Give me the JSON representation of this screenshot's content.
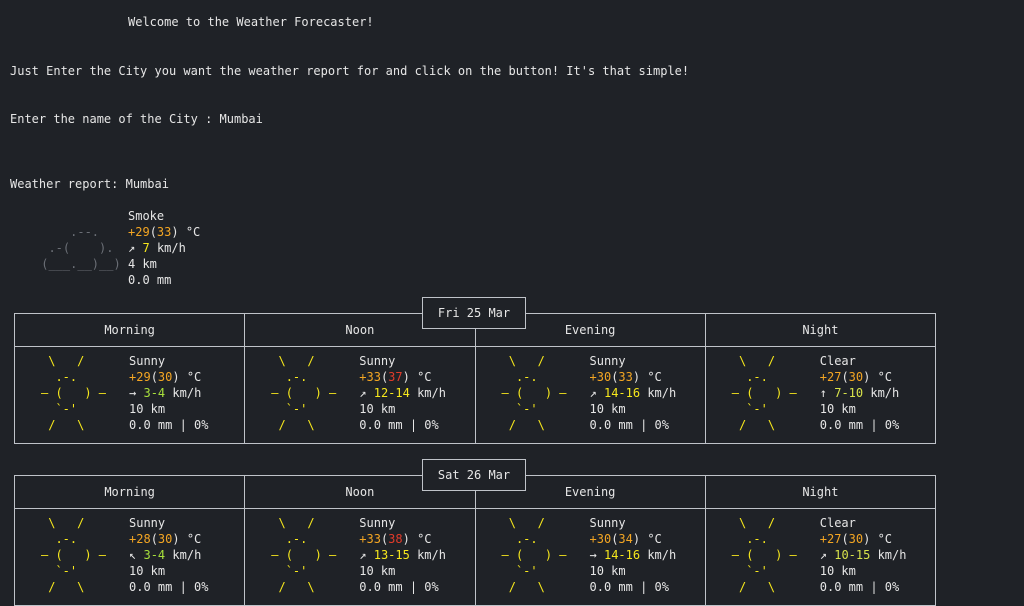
{
  "welcome": "Welcome to the Weather Forecaster!",
  "instructions": "Just Enter the City you want the weather report for and click on the button! It's that simple!",
  "prompt_label": "Enter the name of the City : ",
  "city_value": "Mumbai",
  "report_label": "Weather report: Mumbai",
  "current": {
    "condition": "Smoke",
    "temp_a": "+29",
    "temp_b": "33",
    "temp_unit": "°C",
    "wind_arrow": "↗",
    "wind": "7",
    "wind_unit": "km/h",
    "visibility": "4 km",
    "precip": "0.0 mm"
  },
  "days": [
    {
      "date": "Fri 25 Mar",
      "periods": [
        {
          "name": "Morning",
          "condition": "Sunny",
          "temp_a": "+29",
          "temp_b": "30",
          "temp_b_color": "orange",
          "arrow": "→",
          "wind": "3-4",
          "wind_color": "green",
          "vis": "10 km",
          "precip": "0.0 mm | 0%"
        },
        {
          "name": "Noon",
          "condition": "Sunny",
          "temp_a": "+33",
          "temp_b": "37",
          "temp_b_color": "red",
          "arrow": "↗",
          "wind": "12-14",
          "wind_color": "yellow",
          "vis": "10 km",
          "precip": "0.0 mm | 0%"
        },
        {
          "name": "Evening",
          "condition": "Sunny",
          "temp_a": "+30",
          "temp_b": "33",
          "temp_b_color": "orange",
          "arrow": "↗",
          "wind": "14-16",
          "wind_color": "yellow",
          "vis": "10 km",
          "precip": "0.0 mm | 0%"
        },
        {
          "name": "Night",
          "condition": "Clear",
          "temp_a": "+27",
          "temp_b": "30",
          "temp_b_color": "orange",
          "arrow": "↑",
          "wind": "7-10",
          "wind_color": "yellowgreen",
          "vis": "10 km",
          "precip": "0.0 mm | 0%"
        }
      ]
    },
    {
      "date": "Sat 26 Mar",
      "periods": [
        {
          "name": "Morning",
          "condition": "Sunny",
          "temp_a": "+28",
          "temp_b": "30",
          "temp_b_color": "orange",
          "arrow": "↖",
          "wind": "3-4",
          "wind_color": "green",
          "vis": "10 km",
          "precip": "0.0 mm | 0%"
        },
        {
          "name": "Noon",
          "condition": "Sunny",
          "temp_a": "+33",
          "temp_b": "38",
          "temp_b_color": "red",
          "arrow": "↗",
          "wind": "13-15",
          "wind_color": "yellow",
          "vis": "10 km",
          "precip": "0.0 mm | 0%"
        },
        {
          "name": "Evening",
          "condition": "Sunny",
          "temp_a": "+30",
          "temp_b": "34",
          "temp_b_color": "orange",
          "arrow": "→",
          "wind": "14-16",
          "wind_color": "yellow",
          "vis": "10 km",
          "precip": "0.0 mm | 0%"
        },
        {
          "name": "Night",
          "condition": "Clear",
          "temp_a": "+27",
          "temp_b": "30",
          "temp_b_color": "orange",
          "arrow": "↗",
          "wind": "10-15",
          "wind_color": "yellowgreen",
          "vis": "10 km",
          "precip": "0.0 mm | 0%"
        }
      ]
    }
  ],
  "colors": {
    "orange": "#f4a623",
    "red": "#e23b2a",
    "yellow": "#f7e81c",
    "green": "#a8e03c",
    "yellowgreen": "#d8e34b"
  }
}
